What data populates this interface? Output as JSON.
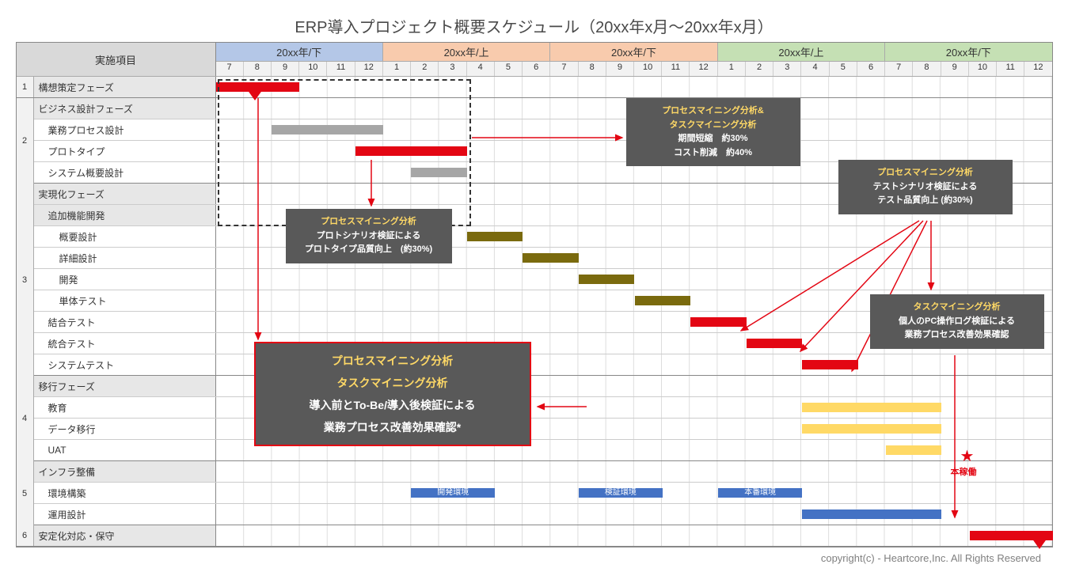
{
  "title": "ERP導入プロジェクト概要スケジュール（20xx年x月〜20xx年x月）",
  "header": {
    "task_col": "実施項目",
    "periods": [
      {
        "label": "20xx年/下",
        "class": "p-blue",
        "months": [
          "7",
          "8",
          "9",
          "10",
          "11",
          "12"
        ]
      },
      {
        "label": "20xx年/上",
        "class": "p-orange",
        "months": [
          "1",
          "2",
          "3",
          "4",
          "5",
          "6"
        ]
      },
      {
        "label": "20xx年/下",
        "class": "p-orange",
        "months": [
          "7",
          "8",
          "9",
          "10",
          "11",
          "12"
        ]
      },
      {
        "label": "20xx年/上",
        "class": "p-green",
        "months": [
          "1",
          "2",
          "3",
          "4",
          "5",
          "6"
        ]
      },
      {
        "label": "20xx年/下",
        "class": "p-green",
        "months": [
          "7",
          "8",
          "9",
          "10",
          "11",
          "12"
        ]
      }
    ]
  },
  "rows": [
    {
      "num": "1",
      "label": "構想策定フェーズ",
      "indent": 0,
      "shade": true,
      "groupEnd": true,
      "bars": [
        {
          "start": 0,
          "span": 3,
          "cls": "b-red"
        }
      ],
      "milestone": {
        "at": 1.4
      }
    },
    {
      "num": "",
      "label": "ビジネス設計フェーズ",
      "indent": 0,
      "shade": true,
      "bars": []
    },
    {
      "num": "",
      "label": "業務プロセス設計",
      "indent": 1,
      "bars": [
        {
          "start": 2,
          "span": 4,
          "cls": "b-gray"
        }
      ]
    },
    {
      "num": "",
      "label": "プロトタイプ",
      "indent": 1,
      "bars": [
        {
          "start": 5,
          "span": 4,
          "cls": "b-red"
        }
      ]
    },
    {
      "num": "",
      "label": "システム概要設計",
      "indent": 1,
      "groupEnd": true,
      "bars": [
        {
          "start": 7,
          "span": 2,
          "cls": "b-gray"
        }
      ]
    },
    {
      "num": "",
      "label": "実現化フェーズ",
      "indent": 0,
      "shade": true,
      "bars": []
    },
    {
      "num": "",
      "label": "追加機能開発",
      "indent": 1,
      "shade": true,
      "bars": []
    },
    {
      "num": "",
      "label": "概要設計",
      "indent": 2,
      "bars": [
        {
          "start": 9,
          "span": 2,
          "cls": "b-olive"
        }
      ]
    },
    {
      "num": "",
      "label": "詳細設計",
      "indent": 2,
      "bars": [
        {
          "start": 11,
          "span": 2,
          "cls": "b-olive"
        }
      ]
    },
    {
      "num": "",
      "label": "開発",
      "indent": 2,
      "bars": [
        {
          "start": 13,
          "span": 2,
          "cls": "b-olive"
        }
      ]
    },
    {
      "num": "",
      "label": "単体テスト",
      "indent": 2,
      "bars": [
        {
          "start": 15,
          "span": 2,
          "cls": "b-olive"
        }
      ]
    },
    {
      "num": "",
      "label": "結合テスト",
      "indent": 1,
      "bars": [
        {
          "start": 17,
          "span": 2,
          "cls": "b-red"
        }
      ]
    },
    {
      "num": "",
      "label": "統合テスト",
      "indent": 1,
      "bars": [
        {
          "start": 19,
          "span": 2,
          "cls": "b-red"
        }
      ]
    },
    {
      "num": "",
      "label": "システムテスト",
      "indent": 1,
      "groupEnd": true,
      "bars": [
        {
          "start": 21,
          "span": 2,
          "cls": "b-red"
        }
      ]
    },
    {
      "num": "",
      "label": "移行フェーズ",
      "indent": 0,
      "shade": true,
      "bars": []
    },
    {
      "num": "",
      "label": "教育",
      "indent": 1,
      "bars": [
        {
          "start": 21,
          "span": 5,
          "cls": "b-yellow"
        }
      ]
    },
    {
      "num": "",
      "label": "データ移行",
      "indent": 1,
      "bars": [
        {
          "start": 21,
          "span": 5,
          "cls": "b-yellow"
        }
      ]
    },
    {
      "num": "",
      "label": "UAT",
      "indent": 1,
      "groupEnd": true,
      "bars": [
        {
          "start": 24,
          "span": 2,
          "cls": "b-yellow"
        }
      ]
    },
    {
      "num": "",
      "label": "インフラ整備",
      "indent": 0,
      "shade": true,
      "bars": []
    },
    {
      "num": "",
      "label": "環境構築",
      "indent": 1,
      "bars": [
        {
          "start": 7,
          "span": 3,
          "cls": "b-blue",
          "text": "開発環境"
        },
        {
          "start": 13,
          "span": 3,
          "cls": "b-blue",
          "text": "検証環境"
        },
        {
          "start": 18,
          "span": 3,
          "cls": "b-blue",
          "text": "本番環境"
        }
      ]
    },
    {
      "num": "",
      "label": "運用設計",
      "indent": 1,
      "groupEnd": true,
      "bars": [
        {
          "start": 21,
          "span": 5,
          "cls": "b-blue"
        }
      ]
    },
    {
      "num": "6",
      "label": "安定化対応・保守",
      "indent": 0,
      "shade": true,
      "groupEnd": true,
      "bars": [
        {
          "start": 27,
          "span": 3,
          "cls": "b-red"
        }
      ],
      "milestone": {
        "at": 29.5
      }
    }
  ],
  "groupNums": [
    {
      "num": "2",
      "rowStart": 1,
      "rowSpan": 4
    },
    {
      "num": "3",
      "rowStart": 5,
      "rowSpan": 9
    },
    {
      "num": "4",
      "rowStart": 14,
      "rowSpan": 4
    },
    {
      "num": "5",
      "rowStart": 18,
      "rowSpan": 3
    }
  ],
  "callouts": {
    "c1": {
      "l1": "プロセスマイニング分析&",
      "l2": "タスクマイニング分析",
      "l3": "期間短縮　約30%",
      "l4": "コスト削減　約40%"
    },
    "c2": {
      "l1": "プロセスマイニング分析",
      "l2": "プロトシナリオ検証による",
      "l3": "プロトタイプ品質向上　(約30%)"
    },
    "c3": {
      "l1": "プロセスマイニング分析",
      "l2": "テストシナリオ検証による",
      "l3": "テスト品質向上 (約30%)"
    },
    "c4": {
      "l1": "タスクマイニング分析",
      "l2": "個人のPC操作ログ検証による",
      "l3": "業務プロセス改善効果確認"
    },
    "c5": {
      "l1": "プロセスマイニング分析",
      "l2": "タスクマイニング分析",
      "l3": "導入前とTo-Be/導入後検証による",
      "l4": "業務プロセス改善効果確認*"
    }
  },
  "star_label": "本稼働",
  "footer": "copyright(c)  - Heartcore,Inc. All Rights Reserved",
  "chart_data": {
    "type": "gantt",
    "title": "ERP導入プロジェクト概要スケジュール（20xx年x月〜20xx年x月）",
    "x_axis": {
      "unit": "month",
      "range": [
        1,
        30
      ],
      "periods": [
        "20xx年/下(7-12)",
        "20xx年/上(1-6)",
        "20xx年/下(7-12)",
        "20xx年/上(1-6)",
        "20xx年/下(7-12)"
      ]
    },
    "tasks": [
      {
        "id": 1,
        "group": "1",
        "name": "構想策定フェーズ",
        "start": 1,
        "end": 3,
        "color": "red",
        "critical": true
      },
      {
        "id": 2,
        "group": "2",
        "name": "業務プロセス設計",
        "start": 3,
        "end": 6,
        "color": "gray"
      },
      {
        "id": 3,
        "group": "2",
        "name": "プロトタイプ",
        "start": 6,
        "end": 9,
        "color": "red",
        "critical": true
      },
      {
        "id": 4,
        "group": "2",
        "name": "システム概要設計",
        "start": 8,
        "end": 9,
        "color": "gray"
      },
      {
        "id": 5,
        "group": "3",
        "name": "概要設計",
        "start": 10,
        "end": 11,
        "color": "olive"
      },
      {
        "id": 6,
        "group": "3",
        "name": "詳細設計",
        "start": 12,
        "end": 13,
        "color": "olive"
      },
      {
        "id": 7,
        "group": "3",
        "name": "開発",
        "start": 14,
        "end": 15,
        "color": "olive"
      },
      {
        "id": 8,
        "group": "3",
        "name": "単体テスト",
        "start": 16,
        "end": 17,
        "color": "olive"
      },
      {
        "id": 9,
        "group": "3",
        "name": "結合テスト",
        "start": 18,
        "end": 19,
        "color": "red",
        "critical": true
      },
      {
        "id": 10,
        "group": "3",
        "name": "統合テスト",
        "start": 20,
        "end": 21,
        "color": "red",
        "critical": true
      },
      {
        "id": 11,
        "group": "3",
        "name": "システムテスト",
        "start": 22,
        "end": 23,
        "color": "red",
        "critical": true
      },
      {
        "id": 12,
        "group": "4",
        "name": "教育",
        "start": 22,
        "end": 26,
        "color": "yellow"
      },
      {
        "id": 13,
        "group": "4",
        "name": "データ移行",
        "start": 22,
        "end": 26,
        "color": "yellow"
      },
      {
        "id": 14,
        "group": "4",
        "name": "UAT",
        "start": 25,
        "end": 26,
        "color": "yellow"
      },
      {
        "id": 15,
        "group": "5",
        "name": "環境構築-開発環境",
        "start": 8,
        "end": 10,
        "color": "blue"
      },
      {
        "id": 16,
        "group": "5",
        "name": "環境構築-検証環境",
        "start": 14,
        "end": 16,
        "color": "blue"
      },
      {
        "id": 17,
        "group": "5",
        "name": "環境構築-本番環境",
        "start": 19,
        "end": 21,
        "color": "blue"
      },
      {
        "id": 18,
        "group": "5",
        "name": "運用設計",
        "start": 22,
        "end": 26,
        "color": "blue"
      },
      {
        "id": 19,
        "group": "6",
        "name": "安定化対応・保守",
        "start": 28,
        "end": 30,
        "color": "red",
        "critical": true
      }
    ],
    "milestones": [
      {
        "name": "本稼働",
        "at": 27
      }
    ],
    "annotations": [
      "プロセスマイニング分析&タスクマイニング分析 期間短縮約30% コスト削減約40%",
      "プロセスマイニング分析 プロトシナリオ検証によるプロトタイプ品質向上(約30%)",
      "プロセスマイニング分析 テストシナリオ検証によるテスト品質向上(約30%)",
      "タスクマイニング分析 個人のPC操作ログ検証による業務プロセス改善効果確認",
      "プロセスマイニング分析 タスクマイニング分析 導入前とTo-Be/導入後検証による業務プロセス改善効果確認*"
    ]
  }
}
